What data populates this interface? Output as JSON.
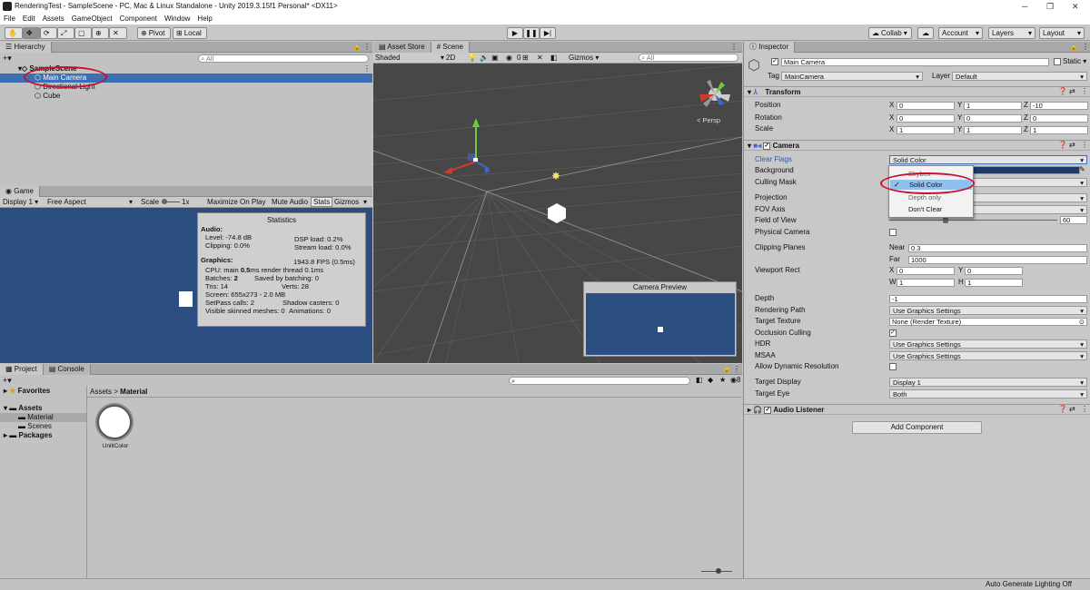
{
  "window": {
    "title": "RenderingTest - SampleScene - PC, Mac & Linux Standalone - Unity 2019.3.15f1 Personal* <DX11>"
  },
  "menu": [
    "File",
    "Edit",
    "Assets",
    "GameObject",
    "Component",
    "Window",
    "Help"
  ],
  "toolbar": {
    "pivot": "Pivot",
    "local": "Local",
    "collab": "Collab",
    "account": "Account",
    "layers": "Layers",
    "layout": "Layout"
  },
  "hierarchy": {
    "tab": "Hierarchy",
    "search_placeholder": "All",
    "items": [
      "SampleScene",
      "Main Camera",
      "Directional Light",
      "Cube"
    ]
  },
  "scene": {
    "tabs": [
      "Asset Store",
      "Scene"
    ],
    "shading": "Shaded",
    "mode2d": "2D",
    "gizmos": "Gizmos",
    "search_placeholder": "All",
    "persp": "< Persp",
    "gizmo_count": "0"
  },
  "game": {
    "tab": "Game",
    "display": "Display 1",
    "aspect": "Free Aspect",
    "scale_label": "Scale",
    "scale_value": "1x",
    "buttons": [
      "Maximize On Play",
      "Mute Audio",
      "Stats",
      "Gizmos"
    ]
  },
  "stats": {
    "title": "Statistics",
    "audio": "Audio:",
    "level": "Level: -74.8 dB",
    "dsp": "DSP load: 0.2%",
    "clipping": "Clipping: 0.0%",
    "stream": "Stream load: 0.0%",
    "graphics": "Graphics:",
    "fps": "1943.8 FPS (0.5ms)",
    "cpu_a": "CPU: main ",
    "cpu_b": "0.5",
    "cpu_c": "ms  render thread 0.1ms",
    "batches_a": "Batches: ",
    "batches_b": "2",
    "saved": "Saved by batching: 0",
    "tris": "Tris: 14",
    "verts": "Verts: 28",
    "screen": "Screen: 655x273 - 2.0 MB",
    "setpass": "SetPass calls: 2",
    "shadow": "Shadow casters: 0",
    "skinned": "Visible skinned meshes: 0",
    "anim": "Animations: 0"
  },
  "camera_preview": {
    "title": "Camera Preview"
  },
  "project": {
    "tabs": [
      "Project",
      "Console"
    ],
    "favorites": "Favorites",
    "assets": "Assets",
    "material": "Material",
    "scenes": "Scenes",
    "packages": "Packages",
    "breadcrumb_root": "Assets",
    "breadcrumb_sep": ">",
    "breadcrumb_leaf": "Material",
    "asset_name": "UnlitColor",
    "hidden_count": "8"
  },
  "inspector": {
    "tab": "Inspector",
    "object_name": "Main Camera",
    "static": "Static",
    "tag_label": "Tag",
    "tag": "MainCamera",
    "layer_label": "Layer",
    "layer": "Default",
    "transform": {
      "title": "Transform",
      "rows": [
        {
          "label": "Position",
          "x": "0",
          "y": "1",
          "z": "-10"
        },
        {
          "label": "Rotation",
          "x": "0",
          "y": "0",
          "z": "0"
        },
        {
          "label": "Scale",
          "x": "1",
          "y": "1",
          "z": "1"
        }
      ]
    },
    "camera": {
      "title": "Camera",
      "clear_flags": "Clear Flags",
      "clear_flags_value": "Solid Color",
      "background": "Background",
      "culling": "Culling Mask",
      "projection": "Projection",
      "fov_axis": "FOV Axis",
      "fov": "Field of View",
      "fov_value": "60",
      "physical": "Physical Camera",
      "clipping": "Clipping Planes",
      "near_label": "Near",
      "near": "0.3",
      "far_label": "Far",
      "far": "1000",
      "viewport": "Viewport Rect",
      "vx": "0",
      "vy": "0",
      "vw": "1",
      "vh": "1",
      "depth": "Depth",
      "depth_value": "-1",
      "rendering_path": "Rendering Path",
      "rendering_path_value": "Use Graphics Settings",
      "target_texture": "Target Texture",
      "target_texture_value": "None (Render Texture)",
      "occlusion": "Occlusion Culling",
      "hdr": "HDR",
      "hdr_value": "Use Graphics Settings",
      "msaa": "MSAA",
      "msaa_value": "Use Graphics Settings",
      "dynres": "Allow Dynamic Resolution",
      "target_display": "Target Display",
      "target_display_value": "Display 1",
      "target_eye": "Target Eye",
      "target_eye_value": "Both"
    },
    "dropdown": [
      "Skybox",
      "Solid Color",
      "Depth only",
      "Don't Clear"
    ],
    "audio_listener": "Audio Listener",
    "add_component": "Add Component"
  },
  "statusbar": {
    "text": "Auto Generate Lighting Off"
  },
  "colors": {
    "game_bg": "#2b4d80",
    "scene_bg": "#474747",
    "select": "#3d6fb5",
    "red": "#c8102e"
  }
}
